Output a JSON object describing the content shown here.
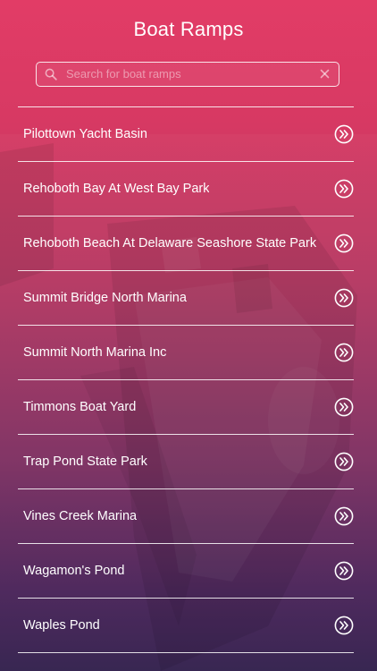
{
  "header": {
    "title": "Boat Ramps"
  },
  "search": {
    "placeholder": "Search for boat ramps",
    "value": "",
    "icon": "search-icon",
    "clear_icon": "close-icon"
  },
  "list": {
    "items": [
      {
        "label": "Pilottown Yacht Basin",
        "icon": "double-chevron-right-icon"
      },
      {
        "label": "Rehoboth Bay At West Bay Park",
        "icon": "double-chevron-right-icon"
      },
      {
        "label": "Rehoboth Beach At Delaware Seashore State Park",
        "icon": "double-chevron-right-icon"
      },
      {
        "label": "Summit Bridge North Marina",
        "icon": "double-chevron-right-icon"
      },
      {
        "label": "Summit North Marina Inc",
        "icon": "double-chevron-right-icon"
      },
      {
        "label": "Timmons Boat Yard",
        "icon": "double-chevron-right-icon"
      },
      {
        "label": "Trap Pond State Park",
        "icon": "double-chevron-right-icon"
      },
      {
        "label": "Vines Creek Marina",
        "icon": "double-chevron-right-icon"
      },
      {
        "label": "Wagamon's Pond",
        "icon": "double-chevron-right-icon"
      },
      {
        "label": "Waples Pond",
        "icon": "double-chevron-right-icon"
      }
    ]
  },
  "colors": {
    "gradient_top": "#e23c66",
    "gradient_bottom": "#32204d",
    "text": "#ffffff"
  }
}
